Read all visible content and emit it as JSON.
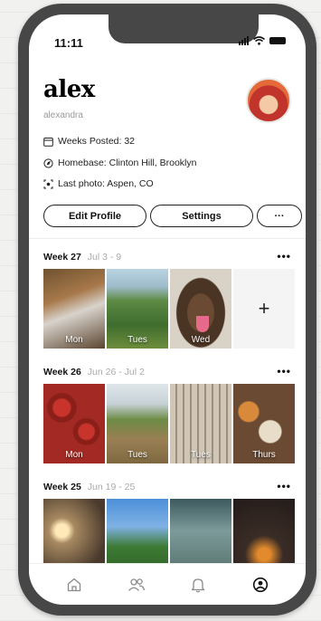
{
  "status": {
    "time": "11:11"
  },
  "profile": {
    "name": "alex",
    "handle": "alexandra",
    "weeks_posted": "Weeks Posted: 32",
    "homebase": "Homebase: Clinton Hill, Brooklyn",
    "last_photo": "Last photo: Aspen, CO"
  },
  "buttons": {
    "edit": "Edit Profile",
    "settings": "Settings",
    "more": "···"
  },
  "weeks": [
    {
      "title": "Week 27",
      "range": "Jul 3 - 9",
      "more": "•••",
      "labels": [
        "Mon",
        "Tues",
        "Wed"
      ],
      "add": "+"
    },
    {
      "title": "Week 26",
      "range": "Jun 26 - Jul 2",
      "more": "•••",
      "labels": [
        "Mon",
        "Tues",
        "Tues",
        "Thurs"
      ]
    },
    {
      "title": "Week 25",
      "range": "Jun 19 - 25",
      "more": "•••"
    }
  ],
  "tabs": [
    "home-icon",
    "friends-icon",
    "notifications-icon",
    "profile-icon"
  ]
}
